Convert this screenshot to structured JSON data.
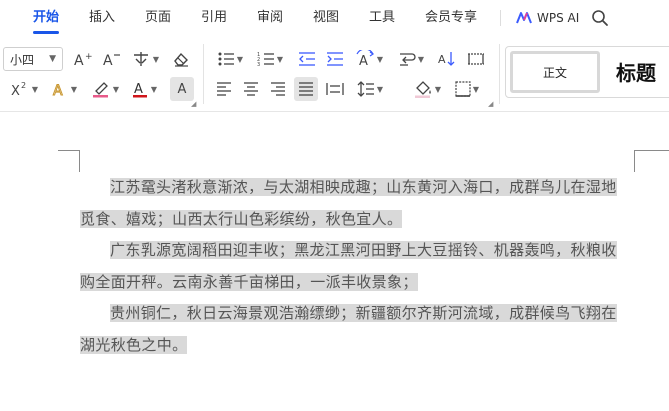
{
  "menu": {
    "items": [
      "开始",
      "插入",
      "页面",
      "引用",
      "审阅",
      "视图",
      "工具",
      "会员专享"
    ],
    "active_index": 0,
    "wps_ai_label": "WPS AI",
    "accent_color": "#1a56e8"
  },
  "ribbon": {
    "font_size_value": "小四",
    "highlight_letter": "A",
    "styles": {
      "normal_label": "正文",
      "heading_label": "标题"
    }
  },
  "document": {
    "paragraphs": [
      {
        "line1": "江苏鼋头渚秋意渐浓，与太湖相映成趣；山东黄河入海口，成群鸟儿在湿地",
        "line2": "觅食、嬉戏；山西太行山色彩缤纷，秋色宜人。"
      },
      {
        "line1": "广东乳源宽阔稻田迎丰收；黑龙江黑河田野上大豆摇铃、机器轰鸣，秋粮收",
        "line2": "购全面开秤。云南永善千亩梯田，一派丰收景象；"
      },
      {
        "line1": "贵州铜仁，秋日云海景观浩瀚缥缈；新疆额尔齐斯河流域，成群候鸟飞翔在",
        "line2": "湖光秋色之中。"
      }
    ],
    "selection_color": "#d9d9d9"
  }
}
